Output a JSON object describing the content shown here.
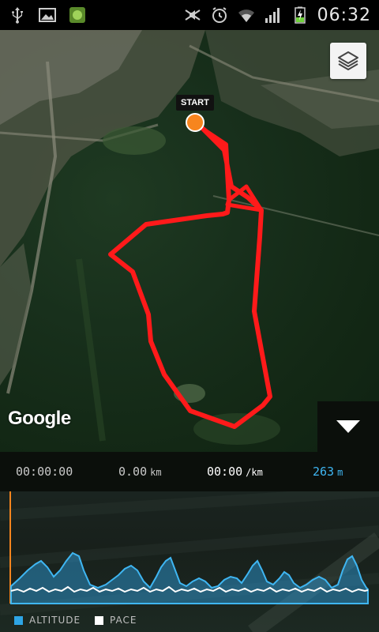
{
  "status_bar": {
    "time": "06:32",
    "icons": [
      "usb-icon",
      "gallery-icon",
      "android-icon",
      "mute-icon",
      "alarm-icon",
      "wifi-icon",
      "signal-icon",
      "battery-charging-icon"
    ]
  },
  "map": {
    "start_label": "START",
    "google_logo": "Google",
    "route_color": "#ff1a1a",
    "start_marker_color": "#f7851e",
    "layers_icon": "layers-icon",
    "collapse_icon": "chevron-down-icon"
  },
  "stats": {
    "duration": "00:00:00",
    "distance": "0.00",
    "distance_unit": "km",
    "pace": "00:00",
    "pace_unit": "/km",
    "altitude": "263",
    "altitude_unit": "m"
  },
  "chart_data": {
    "type": "area",
    "series": [
      {
        "name": "ALTITUDE",
        "color": "#2ea5e6"
      },
      {
        "name": "PACE",
        "color": "#ffffff"
      }
    ],
    "start_marker_color": "#f7851e"
  },
  "legend": {
    "altitude": "ALTITUDE",
    "pace": "PACE"
  }
}
